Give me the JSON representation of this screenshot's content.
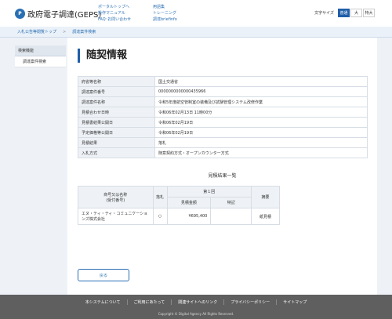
{
  "header": {
    "logo_mark": "P",
    "site_title": "政府電子調達(GEPS)",
    "nav_col1": [
      "ポータルトップへ",
      "操作マニュアル",
      "FAQ･お問い合わせ"
    ],
    "nav_col2": [
      "用語集",
      "トレーニング",
      "調達briefinfo"
    ],
    "font_size_label": "文字サイズ",
    "font_sizes": [
      "普通",
      "大",
      "特大"
    ],
    "font_size_selected": "普通"
  },
  "breadcrumb": {
    "items": [
      "入札公告等閲覧トップ",
      "調達案件検索"
    ],
    "separator": ">"
  },
  "sidebar": {
    "heading": "検索機能",
    "items": [
      "調達案件検索"
    ]
  },
  "main": {
    "title": "随契情報",
    "info_rows": [
      {
        "label": "府省等名称",
        "value": "国土交通省"
      },
      {
        "label": "調達案件番号",
        "value": "0000000000000435966"
      },
      {
        "label": "調達案件名称",
        "value": "令和5年度航空管制室の装備及び試験管理システム改修作業"
      },
      {
        "label": "見積合わせ日時",
        "value": "令和06年02月13日 11時00分"
      },
      {
        "label": "見積書結果公開日",
        "value": "令和06年02月19日"
      },
      {
        "label": "予定価格等公開日",
        "value": "令和06年02月19日"
      },
      {
        "label": "見積結果",
        "value": "落札"
      },
      {
        "label": "入札方式",
        "value": "随意契約方式・オープンカウンター方式"
      }
    ],
    "result_title": "見積結果一覧",
    "result_table": {
      "col_company": "商号又は名称\n(受付番号)",
      "col_win": "落札",
      "col_round": "第１回",
      "col_amount": "見積金額",
      "col_remarks": "特記",
      "col_summary": "摘要",
      "rows": [
        {
          "company": "エヌ・ティ・ティ・コミュニケーションズ株式会社",
          "win": "○",
          "amount": "¥695,400",
          "remarks": "",
          "summary": "紙見積"
        }
      ]
    },
    "back_button": "戻る"
  },
  "footer": {
    "links": [
      "本システムについて",
      "ご利用にあたって",
      "関連サイトへのリンク",
      "プライバシーポリシー",
      "サイトマップ"
    ],
    "copyright": "Copyright © Digital Agency All Rights Reserved."
  },
  "colors": {
    "accent": "#1f5ea8",
    "link": "#2a6fb3",
    "footer_bg": "#5f5f5f",
    "table_header_bg": "#eef2f6"
  }
}
